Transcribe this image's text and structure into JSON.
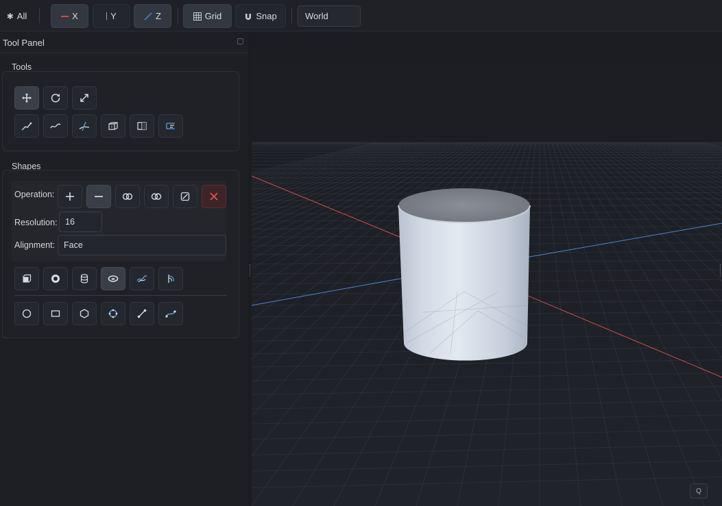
{
  "toolbar": {
    "all_label": "All",
    "x_label": "X",
    "y_label": "Y",
    "z_label": "Z",
    "grid_label": "Grid",
    "snap_label": "Snap",
    "space_value": "World"
  },
  "panel": {
    "title": "Tool Panel",
    "tools_label": "Tools",
    "shapes_label": "Shapes",
    "operation_label": "Operation:",
    "resolution_label": "Resolution:",
    "resolution_value": "16",
    "alignment_label": "Alignment:",
    "alignment_value": "Face"
  },
  "colors": {
    "x_axis": "#d24b4b",
    "y_axis": "#9aa0a8",
    "z_axis": "#4a86d8",
    "danger": "#e05555",
    "icon_accent": "#5a9be0"
  },
  "icons": {
    "transform_tools": [
      "move-icon",
      "rotate-icon",
      "scale-icon"
    ],
    "path_tools": [
      "line-icon",
      "curve-icon",
      "cut-icon",
      "extrude-icon",
      "mirror-icon",
      "align-icon"
    ],
    "operations": [
      "add-icon",
      "subtract-icon",
      "intersect-icon",
      "union-icon",
      "slice-icon",
      "delete-icon"
    ],
    "solids": [
      "cube-icon",
      "sphere-icon",
      "cylinder-icon",
      "torus-icon",
      "surface-icon",
      "revolve-icon"
    ],
    "primitives_2d": [
      "circle-icon",
      "rectangle-icon",
      "hexagon-icon",
      "polygon-icon",
      "segment-icon",
      "spline-icon"
    ]
  },
  "viewport": {
    "corner_label": "Q",
    "selected_shape": "cylinder",
    "active_solid_tool": "torus",
    "active_transform_tool": "move",
    "active_operation": "subtract"
  }
}
